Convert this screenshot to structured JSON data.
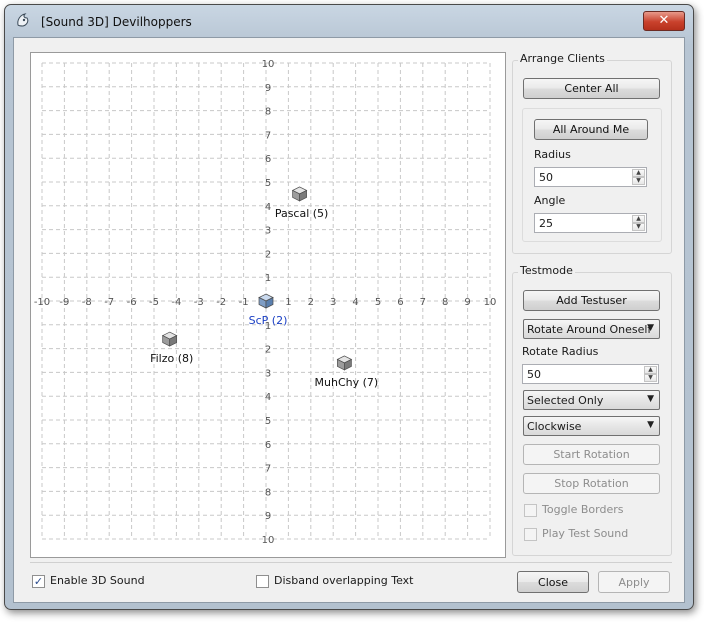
{
  "window": {
    "title": "[Sound 3D] Devilhoppers",
    "close_glyph": "✕"
  },
  "chart_data": {
    "type": "scatter",
    "xlim": [
      -10,
      10
    ],
    "ylim": [
      -10,
      10
    ],
    "grid": true,
    "tick_labels": [
      "-10",
      "-9",
      "-8",
      "-7",
      "-6",
      "-5",
      "-4",
      "-3",
      "-2",
      "-1",
      "1",
      "2",
      "3",
      "4",
      "5",
      "6",
      "7",
      "8",
      "9",
      "10"
    ],
    "y_tick_labels": [
      "10",
      "9",
      "8",
      "7",
      "6",
      "5",
      "4",
      "3",
      "2",
      "1",
      "1",
      "2",
      "3",
      "4",
      "5",
      "6",
      "7",
      "8",
      "9",
      "10"
    ],
    "points": [
      {
        "label": "Pascal (5)",
        "x": 1.5,
        "y": 4.5,
        "color": "#111111"
      },
      {
        "label": "ScP (2)",
        "x": 0,
        "y": 0,
        "color": "#1a3fc4",
        "selected": true
      },
      {
        "label": "Filzo (8)",
        "x": -4.3,
        "y": -1.6,
        "color": "#111111"
      },
      {
        "label": "MuhChy (7)",
        "x": 3.5,
        "y": -2.6,
        "color": "#111111"
      }
    ]
  },
  "arrange": {
    "title": "Arrange Clients",
    "center_all": "Center All",
    "all_around_me": "All Around Me",
    "radius_label": "Radius",
    "radius_value": "50",
    "angle_label": "Angle",
    "angle_value": "25"
  },
  "testmode": {
    "title": "Testmode",
    "add_testuser": "Add Testuser",
    "mode_select": "Rotate Around Oneself",
    "rotate_radius_label": "Rotate Radius",
    "rotate_radius_value": "50",
    "selection_select": "Selected Only",
    "direction_select": "Clockwise",
    "start_rotation": "Start Rotation",
    "stop_rotation": "Stop Rotation",
    "toggle_borders": "Toggle Borders",
    "play_test_sound": "Play Test Sound"
  },
  "footer": {
    "enable_3d_sound": "Enable 3D Sound",
    "enable_3d_checked": true,
    "disband_text": "Disband overlapping Text",
    "disband_checked": false,
    "close": "Close",
    "apply": "Apply"
  }
}
